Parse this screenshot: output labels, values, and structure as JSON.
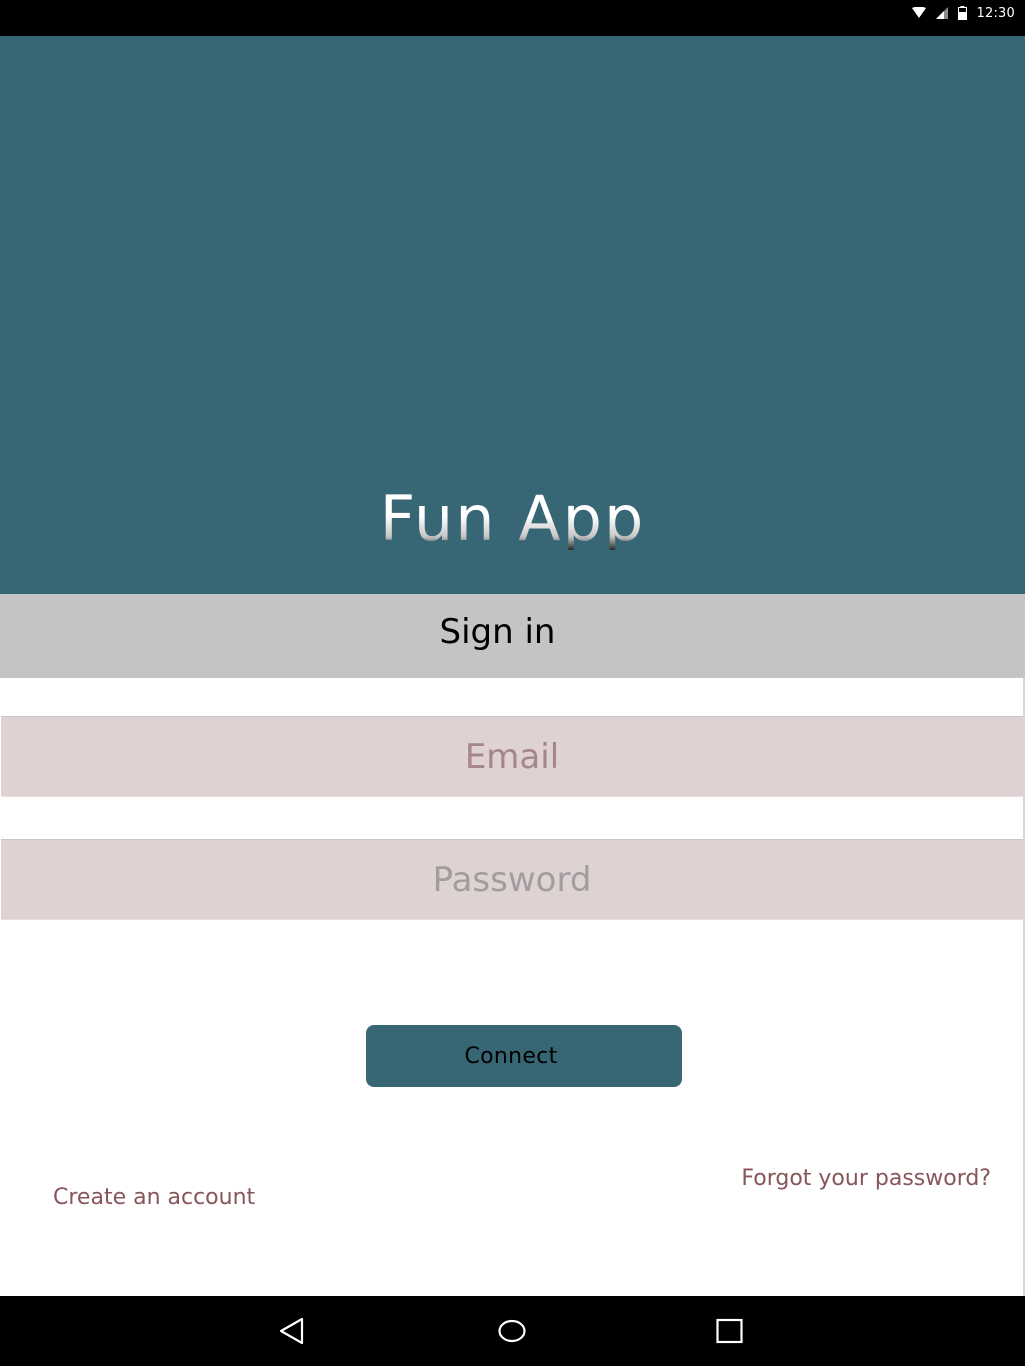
{
  "status_bar": {
    "time": "12:30",
    "icons": [
      "wifi-icon",
      "cellular-signal-icon",
      "battery-icon"
    ]
  },
  "header": {
    "app_title": "Fun App",
    "background_color": "#376675"
  },
  "signin": {
    "label": "Sign in"
  },
  "form": {
    "email": {
      "placeholder": "Email",
      "value": ""
    },
    "password": {
      "placeholder": "Password",
      "value": ""
    },
    "connect_label": "Connect"
  },
  "links": {
    "create_account": "Create an account",
    "forgot_password": "Forgot your password?"
  },
  "nav_bar": {
    "buttons": [
      "back-icon",
      "home-icon",
      "recents-icon"
    ]
  },
  "colors": {
    "accent": "#376675",
    "signin_bar": "#c4c4c4",
    "input_background": "#ded2d3",
    "link": "#87555a"
  }
}
